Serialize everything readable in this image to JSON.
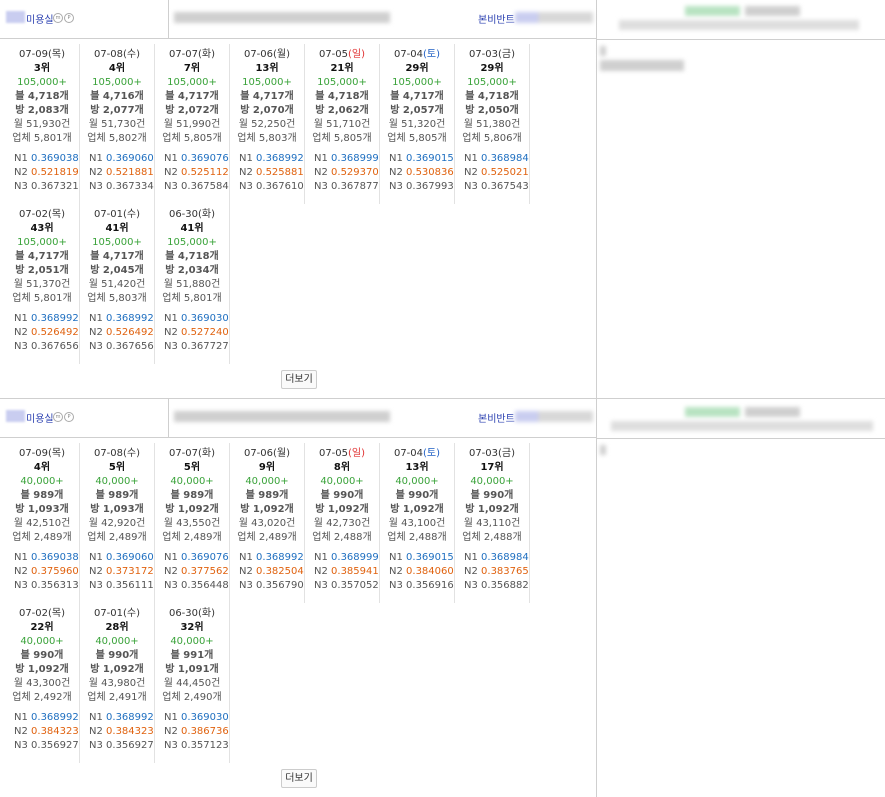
{
  "sections": [
    {
      "shop_name": "미용실",
      "badge_labels": [
        "m",
        "P"
      ],
      "brand_label": "본비반트",
      "more_label": "더보기",
      "days": [
        {
          "date": "07-09",
          "dow": "(목)",
          "dow_type": "weekday",
          "rank": "3위",
          "price": "105,000+",
          "blog": "블 4,718개",
          "visit": "방 2,083개",
          "month": "월 51,930건",
          "biz": "업체 5,801개",
          "n1": "0.369038",
          "n2": "0.521819",
          "n3": "0.367321"
        },
        {
          "date": "07-08",
          "dow": "(수)",
          "dow_type": "weekday",
          "rank": "4위",
          "price": "105,000+",
          "blog": "블 4,716개",
          "visit": "방 2,077개",
          "month": "월 51,730건",
          "biz": "업체 5,802개",
          "n1": "0.369060",
          "n2": "0.521881",
          "n3": "0.367334"
        },
        {
          "date": "07-07",
          "dow": "(화)",
          "dow_type": "weekday",
          "rank": "7위",
          "price": "105,000+",
          "blog": "블 4,717개",
          "visit": "방 2,072개",
          "month": "월 51,990건",
          "biz": "업체 5,805개",
          "n1": "0.369076",
          "n2": "0.525112",
          "n3": "0.367584"
        },
        {
          "date": "07-06",
          "dow": "(월)",
          "dow_type": "weekday",
          "rank": "13위",
          "price": "105,000+",
          "blog": "블 4,717개",
          "visit": "방 2,070개",
          "month": "월 52,250건",
          "biz": "업체 5,803개",
          "n1": "0.368992",
          "n2": "0.525881",
          "n3": "0.367610"
        },
        {
          "date": "07-05",
          "dow": "(일)",
          "dow_type": "sun",
          "rank": "21위",
          "price": "105,000+",
          "blog": "블 4,718개",
          "visit": "방 2,062개",
          "month": "월 51,710건",
          "biz": "업체 5,805개",
          "n1": "0.368999",
          "n2": "0.529370",
          "n3": "0.367877"
        },
        {
          "date": "07-04",
          "dow": "(토)",
          "dow_type": "sat",
          "rank": "29위",
          "price": "105,000+",
          "blog": "블 4,717개",
          "visit": "방 2,057개",
          "month": "월 51,320건",
          "biz": "업체 5,805개",
          "n1": "0.369015",
          "n2": "0.530836",
          "n3": "0.367993"
        },
        {
          "date": "07-03",
          "dow": "(금)",
          "dow_type": "weekday",
          "rank": "29위",
          "price": "105,000+",
          "blog": "블 4,718개",
          "visit": "방 2,050개",
          "month": "월 51,380건",
          "biz": "업체 5,806개",
          "n1": "0.368984",
          "n2": "0.525021",
          "n3": "0.367543"
        },
        {
          "date": "07-02",
          "dow": "(목)",
          "dow_type": "weekday",
          "rank": "43위",
          "price": "105,000+",
          "blog": "블 4,717개",
          "visit": "방 2,051개",
          "month": "월 51,370건",
          "biz": "업체 5,801개",
          "n1": "0.368992",
          "n2": "0.526492",
          "n3": "0.367656"
        },
        {
          "date": "07-01",
          "dow": "(수)",
          "dow_type": "weekday",
          "rank": "41위",
          "price": "105,000+",
          "blog": "블 4,717개",
          "visit": "방 2,045개",
          "month": "월 51,420건",
          "biz": "업체 5,803개",
          "n1": "0.368992",
          "n2": "0.526492",
          "n3": "0.367656"
        },
        {
          "date": "06-30",
          "dow": "(화)",
          "dow_type": "weekday",
          "rank": "41위",
          "price": "105,000+",
          "blog": "블 4,718개",
          "visit": "방 2,034개",
          "month": "월 51,880건",
          "biz": "업체 5,801개",
          "n1": "0.369030",
          "n2": "0.527240",
          "n3": "0.367727"
        }
      ]
    },
    {
      "shop_name": "미용실",
      "badge_labels": [
        "m",
        "P"
      ],
      "brand_label": "본비반트",
      "more_label": "더보기",
      "days": [
        {
          "date": "07-09",
          "dow": "(목)",
          "dow_type": "weekday",
          "rank": "4위",
          "price": "40,000+",
          "blog": "블 989개",
          "visit": "방 1,093개",
          "month": "월 42,510건",
          "biz": "업체 2,489개",
          "n1": "0.369038",
          "n2": "0.375960",
          "n3": "0.356313"
        },
        {
          "date": "07-08",
          "dow": "(수)",
          "dow_type": "weekday",
          "rank": "5위",
          "price": "40,000+",
          "blog": "블 989개",
          "visit": "방 1,093개",
          "month": "월 42,920건",
          "biz": "업체 2,489개",
          "n1": "0.369060",
          "n2": "0.373172",
          "n3": "0.356111"
        },
        {
          "date": "07-07",
          "dow": "(화)",
          "dow_type": "weekday",
          "rank": "5위",
          "price": "40,000+",
          "blog": "블 989개",
          "visit": "방 1,092개",
          "month": "월 43,550건",
          "biz": "업체 2,489개",
          "n1": "0.369076",
          "n2": "0.377562",
          "n3": "0.356448"
        },
        {
          "date": "07-06",
          "dow": "(월)",
          "dow_type": "weekday",
          "rank": "9위",
          "price": "40,000+",
          "blog": "블 989개",
          "visit": "방 1,092개",
          "month": "월 43,020건",
          "biz": "업체 2,489개",
          "n1": "0.368992",
          "n2": "0.382504",
          "n3": "0.356790"
        },
        {
          "date": "07-05",
          "dow": "(일)",
          "dow_type": "sun",
          "rank": "8위",
          "price": "40,000+",
          "blog": "블 990개",
          "visit": "방 1,092개",
          "month": "월 42,730건",
          "biz": "업체 2,488개",
          "n1": "0.368999",
          "n2": "0.385941",
          "n3": "0.357052"
        },
        {
          "date": "07-04",
          "dow": "(토)",
          "dow_type": "sat",
          "rank": "13위",
          "price": "40,000+",
          "blog": "블 990개",
          "visit": "방 1,092개",
          "month": "월 43,100건",
          "biz": "업체 2,488개",
          "n1": "0.369015",
          "n2": "0.384060",
          "n3": "0.356916"
        },
        {
          "date": "07-03",
          "dow": "(금)",
          "dow_type": "weekday",
          "rank": "17위",
          "price": "40,000+",
          "blog": "블 990개",
          "visit": "방 1,092개",
          "month": "월 43,110건",
          "biz": "업체 2,488개",
          "n1": "0.368984",
          "n2": "0.383765",
          "n3": "0.356882"
        },
        {
          "date": "07-02",
          "dow": "(목)",
          "dow_type": "weekday",
          "rank": "22위",
          "price": "40,000+",
          "blog": "블 990개",
          "visit": "방 1,092개",
          "month": "월 43,300건",
          "biz": "업체 2,492개",
          "n1": "0.368992",
          "n2": "0.384323",
          "n3": "0.356927"
        },
        {
          "date": "07-01",
          "dow": "(수)",
          "dow_type": "weekday",
          "rank": "28위",
          "price": "40,000+",
          "blog": "블 990개",
          "visit": "방 1,092개",
          "month": "월 43,980건",
          "biz": "업체 2,491개",
          "n1": "0.368992",
          "n2": "0.384323",
          "n3": "0.356927"
        },
        {
          "date": "06-30",
          "dow": "(화)",
          "dow_type": "weekday",
          "rank": "32위",
          "price": "40,000+",
          "blog": "블 991개",
          "visit": "방 1,091개",
          "month": "월 44,450건",
          "biz": "업체 2,490개",
          "n1": "0.369030",
          "n2": "0.386736",
          "n3": "0.357123"
        }
      ]
    }
  ],
  "labels": {
    "n1": "N1",
    "n2": "N2",
    "n3": "N3"
  },
  "colors": {
    "n1": "#1f6fc0",
    "n2": "#e0620f",
    "price": "#3aa33a",
    "link": "#2a3fb0",
    "sat": "#1f5fc4",
    "sun": "#e03030"
  }
}
